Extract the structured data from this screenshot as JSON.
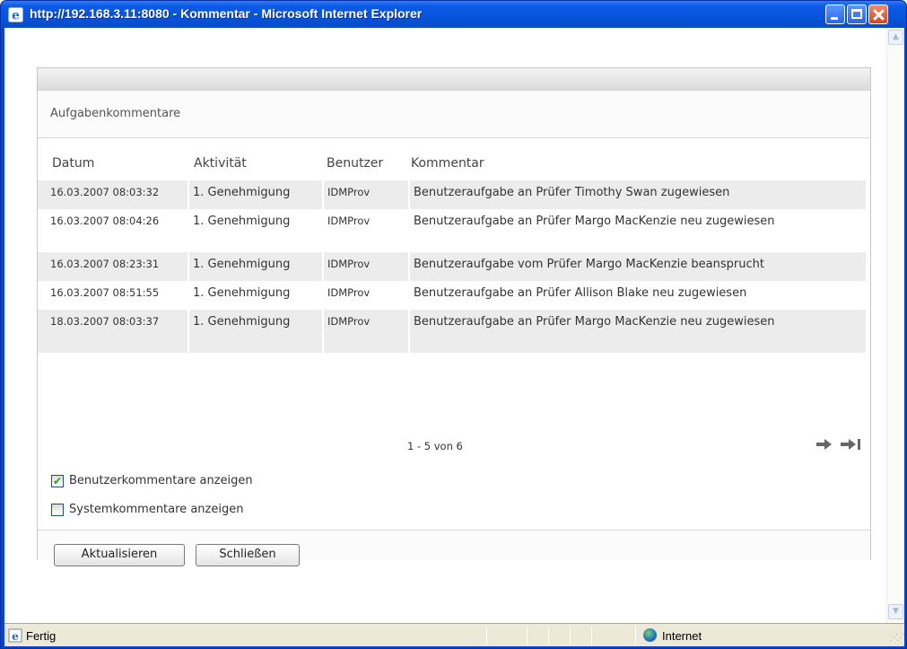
{
  "window": {
    "title": "http://192.168.3.11:8080 - Kommentar - Microsoft Internet Explorer"
  },
  "panel": {
    "title": "Aufgabenkommentare",
    "columns": [
      "Datum",
      "Aktivität",
      "Benutzer",
      "Kommentar"
    ],
    "rows": [
      {
        "date": "16.03.2007 08:03:32",
        "activity": "1. Genehmigung",
        "user": "IDMProv",
        "comment": "Benutzeraufgabe an Prüfer Timothy Swan zugewiesen"
      },
      {
        "date": "16.03.2007 08:04:26",
        "activity": "1. Genehmigung",
        "user": "IDMProv",
        "comment": "Benutzeraufgabe an Prüfer Margo MacKenzie neu zugewiesen"
      },
      {
        "date": "16.03.2007 08:23:31",
        "activity": "1. Genehmigung",
        "user": "IDMProv",
        "comment": "Benutzeraufgabe vom Prüfer Margo MacKenzie beansprucht"
      },
      {
        "date": "16.03.2007 08:51:55",
        "activity": "1. Genehmigung",
        "user": "IDMProv",
        "comment": "Benutzeraufgabe an Prüfer Allison Blake neu zugewiesen"
      },
      {
        "date": "18.03.2007 08:03:37",
        "activity": "1. Genehmigung",
        "user": "IDMProv",
        "comment": "Benutzeraufgabe an Prüfer Margo MacKenzie neu zugewiesen"
      }
    ],
    "pager": {
      "info": "1 - 5 von 6"
    },
    "options": {
      "user_comments": {
        "label": "Benutzerkommentare anzeigen",
        "checked": true
      },
      "system_comments": {
        "label": "Systemkommentare anzeigen",
        "checked": false
      }
    },
    "buttons": {
      "refresh": "Aktualisieren",
      "close": "Schließen"
    }
  },
  "statusbar": {
    "status": "Fertig",
    "zone": "Internet"
  },
  "colors": {
    "titlebar": "#0b5ae6",
    "row_shade": "#ececec",
    "check": "#21a121"
  }
}
